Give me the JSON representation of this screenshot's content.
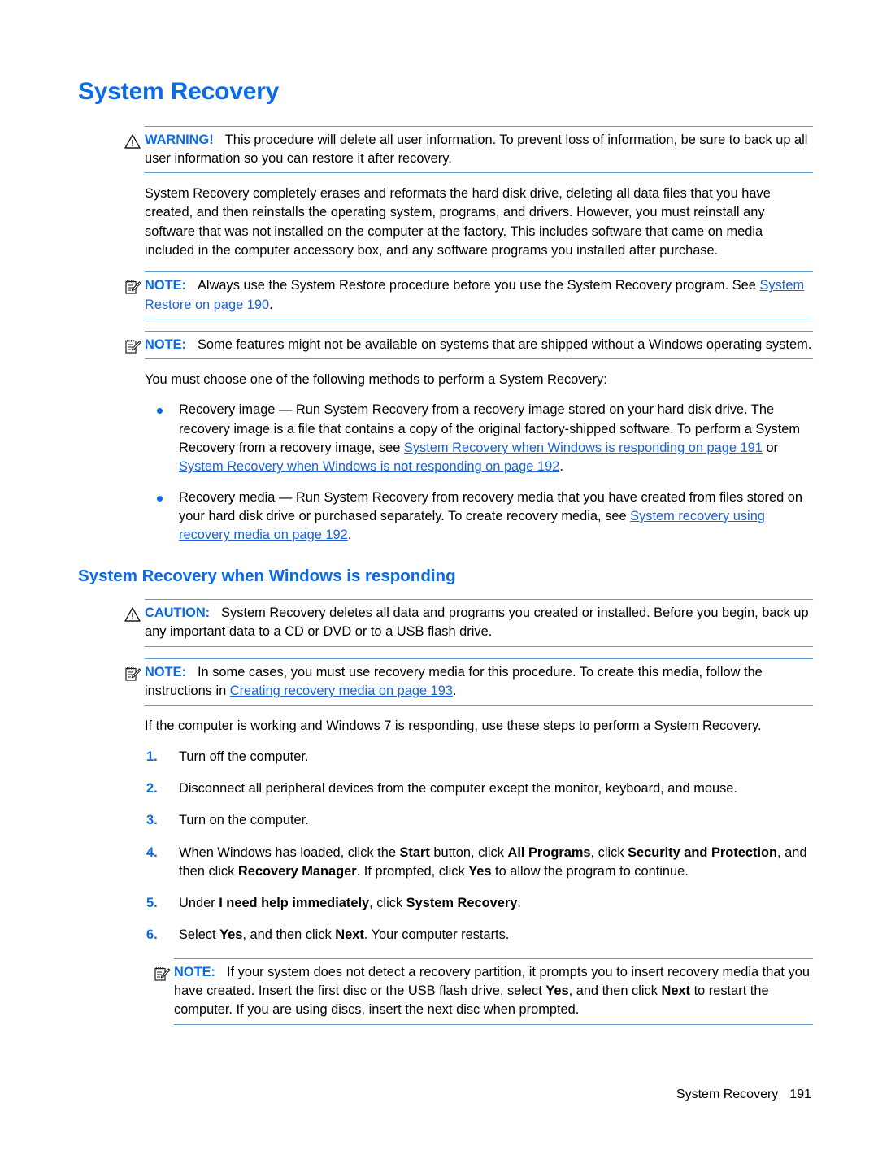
{
  "page": {
    "title": "System Recovery",
    "footer_title": "System Recovery",
    "footer_page": "191"
  },
  "colors": {
    "heading_blue": "#0a6ae8",
    "link_blue": "#1a62d8",
    "rule_blue": "#5b9bd5",
    "bullet_blue": "#0a6ae8",
    "body_text": "#000000"
  },
  "warning_notice": {
    "icon": "warning-triangle-icon",
    "label": "WARNING!",
    "text": "This procedure will delete all user information. To prevent loss of information, be sure to back up all user information so you can restore it after recovery."
  },
  "intro_paragraph": "System Recovery completely erases and reformats the hard disk drive, deleting all data files that you have created, and then reinstalls the operating system, programs, and drivers. However, you must reinstall any software that was not installed on the computer at the factory. This includes software that came on media included in the computer accessory box, and any software programs you installed after purchase.",
  "note_restore": {
    "icon": "note-pad-icon",
    "label": "NOTE:",
    "text_before_link": "Always use the System Restore procedure before you use the System Recovery program. See ",
    "link": "System Restore on page 190",
    "text_after_link": "."
  },
  "note_features": {
    "icon": "note-pad-icon",
    "label": "NOTE:",
    "text": "Some features might not be available on systems that are shipped without a Windows operating system."
  },
  "methods_lead": "You must choose one of the following methods to perform a System Recovery:",
  "methods": [
    {
      "text_before": "Recovery image — Run System Recovery from a recovery image stored on your hard disk drive. The recovery image is a file that contains a copy of the original factory-shipped software. To perform a System Recovery from a recovery image, see ",
      "link1": "System Recovery when Windows is responding on page 191",
      "between": " or ",
      "link2": "System Recovery when Windows is not responding on page 192",
      "text_after": "."
    },
    {
      "text_before": "Recovery media — Run System Recovery from recovery media that you have created from files stored on your hard disk drive or purchased separately. To create recovery media, see ",
      "link1": "System recovery using recovery media on page 192",
      "between": "",
      "link2": "",
      "text_after": "."
    }
  ],
  "section_heading": "System Recovery when Windows is responding",
  "caution_notice": {
    "icon": "warning-triangle-icon",
    "label": "CAUTION:",
    "text": "System Recovery deletes all data and programs you created or installed. Before you begin, back up any important data to a CD or DVD or to a USB flash drive."
  },
  "note_media": {
    "icon": "note-pad-icon",
    "label": "NOTE:",
    "text_before_link": "In some cases, you must use recovery media for this procedure. To create this media, follow the instructions in ",
    "link": "Creating recovery media on page 193",
    "text_after_link": "."
  },
  "steps_lead": "If the computer is working and Windows 7 is responding, use these steps to perform a System Recovery.",
  "steps": [
    {
      "num": "1.",
      "plain": "Turn off the computer."
    },
    {
      "num": "2.",
      "plain": "Disconnect all peripheral devices from the computer except the monitor, keyboard, and mouse."
    },
    {
      "num": "3.",
      "plain": "Turn on the computer."
    },
    {
      "num": "4.",
      "seg_a": "When Windows has loaded, click the ",
      "bold_a": "Start",
      "seg_b": " button, click ",
      "bold_b": "All Programs",
      "seg_c": ", click ",
      "bold_c": "Security and Protection",
      "seg_d": ", and then click ",
      "bold_d": "Recovery Manager",
      "seg_e": ". If prompted, click ",
      "bold_e": "Yes",
      "seg_f": " to allow the program to continue."
    },
    {
      "num": "5.",
      "seg_a": "Under ",
      "bold_a": "I need help immediately",
      "seg_b": ", click ",
      "bold_b": "System Recovery",
      "seg_c": "."
    },
    {
      "num": "6.",
      "seg_a": "Select ",
      "bold_a": "Yes",
      "seg_b": ", and then click ",
      "bold_b": "Next",
      "seg_c": ". Your computer restarts."
    }
  ],
  "note_partition": {
    "icon": "note-pad-icon",
    "label": "NOTE:",
    "seg_a": "If your system does not detect a recovery partition, it prompts you to insert recovery media that you have created. Insert the first disc or the USB flash drive, select ",
    "bold_a": "Yes",
    "seg_b": ", and then click ",
    "bold_b": "Next",
    "seg_c": " to restart the computer. If you are using discs, insert the next disc when prompted."
  }
}
